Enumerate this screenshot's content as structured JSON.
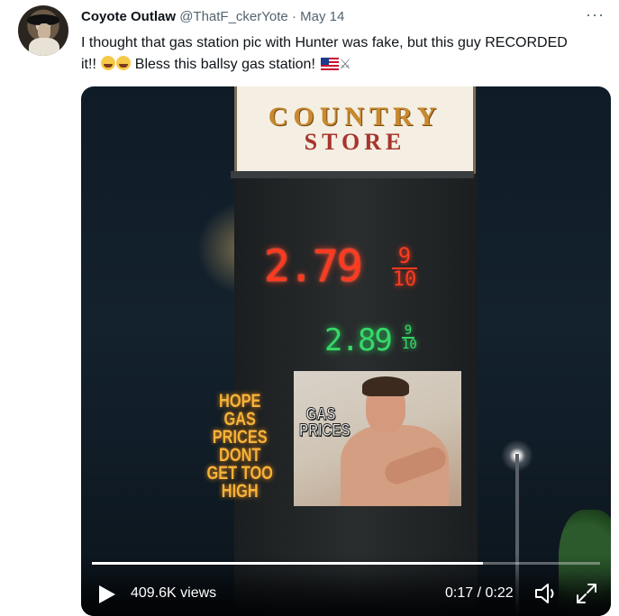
{
  "tweet": {
    "author_name": "Coyote Outlaw",
    "handle": "@ThatF_ckerYote",
    "separator": "·",
    "date": "May 14",
    "more_label": "···",
    "text_part1": "I thought that gas station pic with Hunter was fake, but this guy RECORDED it!!",
    "text_part2": "Bless this ballsy gas station!"
  },
  "video": {
    "sign_line1": "COUNTRY",
    "sign_line2": "STORE",
    "price_big": "2.79",
    "price_big_frac_num": "9",
    "price_big_frac_den": "10",
    "price_small": "2.89",
    "price_small_frac_num": "9",
    "price_small_frac_den": "10",
    "led_message": "HOPE GAS PRICES DONT GET TOO HIGH",
    "photo_caption": "GAS PRICES",
    "views": "409.6K views",
    "time": "0:17 / 0:22",
    "progress_fraction": 0.77
  },
  "icons": {
    "play": "play-icon",
    "volume": "volume-icon",
    "expand": "expand-icon",
    "more": "more-icon"
  }
}
